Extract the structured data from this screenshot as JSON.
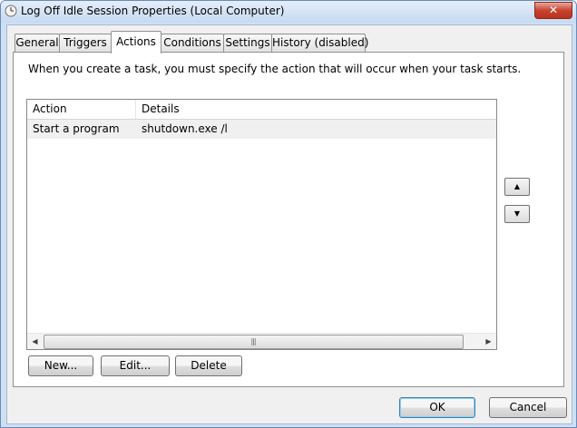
{
  "window": {
    "title": "Log Off Idle Session Properties (Local Computer)",
    "close_label": "✕"
  },
  "tabs": [
    {
      "label": "General"
    },
    {
      "label": "Triggers"
    },
    {
      "label": "Actions",
      "active": true
    },
    {
      "label": "Conditions"
    },
    {
      "label": "Settings"
    },
    {
      "label": "History (disabled)"
    }
  ],
  "actions_page": {
    "description": "When you create a task, you must specify the action that will occur when your task starts.",
    "columns": [
      "Action",
      "Details"
    ],
    "rows": [
      {
        "action": "Start a program",
        "details": "shutdown.exe /l"
      }
    ],
    "new_label": "New...",
    "edit_label": "Edit...",
    "delete_label": "Delete"
  },
  "footer": {
    "ok_label": "OK",
    "cancel_label": "Cancel"
  }
}
